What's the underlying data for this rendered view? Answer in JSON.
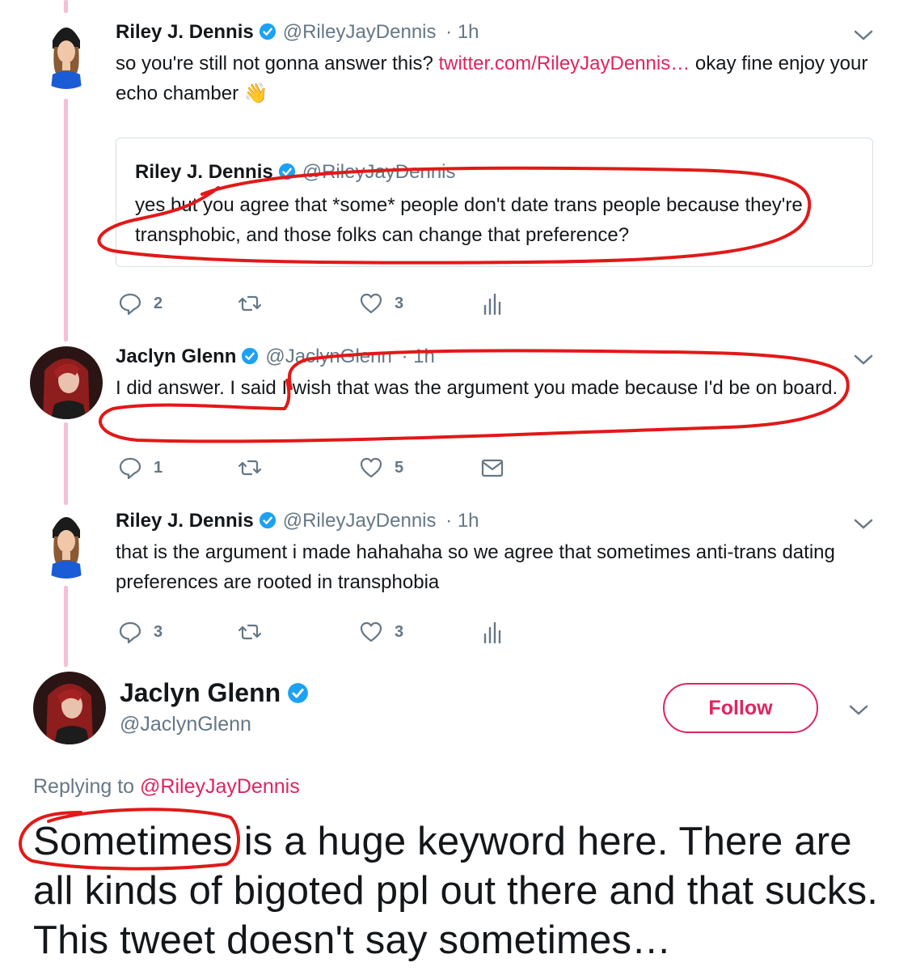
{
  "colors": {
    "link": "#e0245e",
    "secondary_text": "#657786",
    "verified": "#1da1f2",
    "thread_line": "#f6bfd6",
    "annotation": "#e31818"
  },
  "tweets": [
    {
      "name": "Riley J. Dennis",
      "handle": "@RileyJayDennis",
      "time": "· 1h",
      "text_before": "so you're still not gonna answer this? ",
      "link": "twitter.com/RileyJayDennis…",
      "text_after": " okay fine enjoy your echo chamber 👋",
      "quoted": {
        "name": "Riley J. Dennis",
        "handle": "@RileyJayDennis",
        "text": "yes but you agree that *some* people don't date trans people because they're transphobic, and those folks can change that preference?"
      },
      "actions": {
        "replies": "2",
        "likes": "3"
      }
    },
    {
      "name": "Jaclyn Glenn",
      "handle": "@JaclynGlenn",
      "time": "· 1h",
      "text": "I did answer. I said I wish that was the argument you made because I'd be on board.",
      "actions": {
        "replies": "1",
        "likes": "5"
      }
    },
    {
      "name": "Riley J. Dennis",
      "handle": "@RileyJayDennis",
      "time": "· 1h",
      "text": "that is the argument i made hahahaha so we agree that sometimes anti-trans dating preferences are rooted in transphobia",
      "actions": {
        "replies": "3",
        "likes": "3"
      }
    }
  ],
  "main_tweet": {
    "name": "Jaclyn Glenn",
    "handle": "@JaclynGlenn",
    "follow_label": "Follow",
    "replying_prefix": "Replying to ",
    "replying_handle": "@RileyJayDennis",
    "text_first_word": "Sometimes",
    "text_rest": " is a huge keyword here. There are all kinds of bigoted ppl out there and that sucks. This tweet doesn't say sometimes…"
  }
}
